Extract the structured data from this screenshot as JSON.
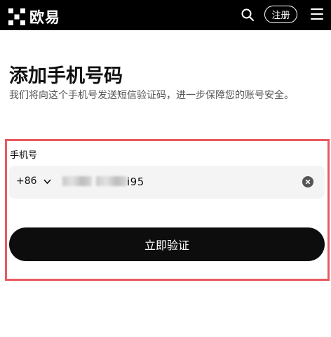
{
  "header": {
    "brand": "欧易",
    "register_label": "注册",
    "icons": {
      "search": "search-icon",
      "menu": "menu-icon",
      "logo": "okx-logo-icon"
    }
  },
  "main": {
    "title": "添加手机号码",
    "description": "我们将向这个手机号发送短信验证码，进一步保障您的账号安全。",
    "phone_label": "手机号",
    "country_code": "+86",
    "phone_value_visible_tail": "i95",
    "verify_button_label": "立即验证"
  },
  "colors": {
    "topbar_bg": "#000000",
    "highlight_border": "#e85a60",
    "field_bg": "#f4f4f4",
    "button_bg": "#0d0d0d"
  }
}
